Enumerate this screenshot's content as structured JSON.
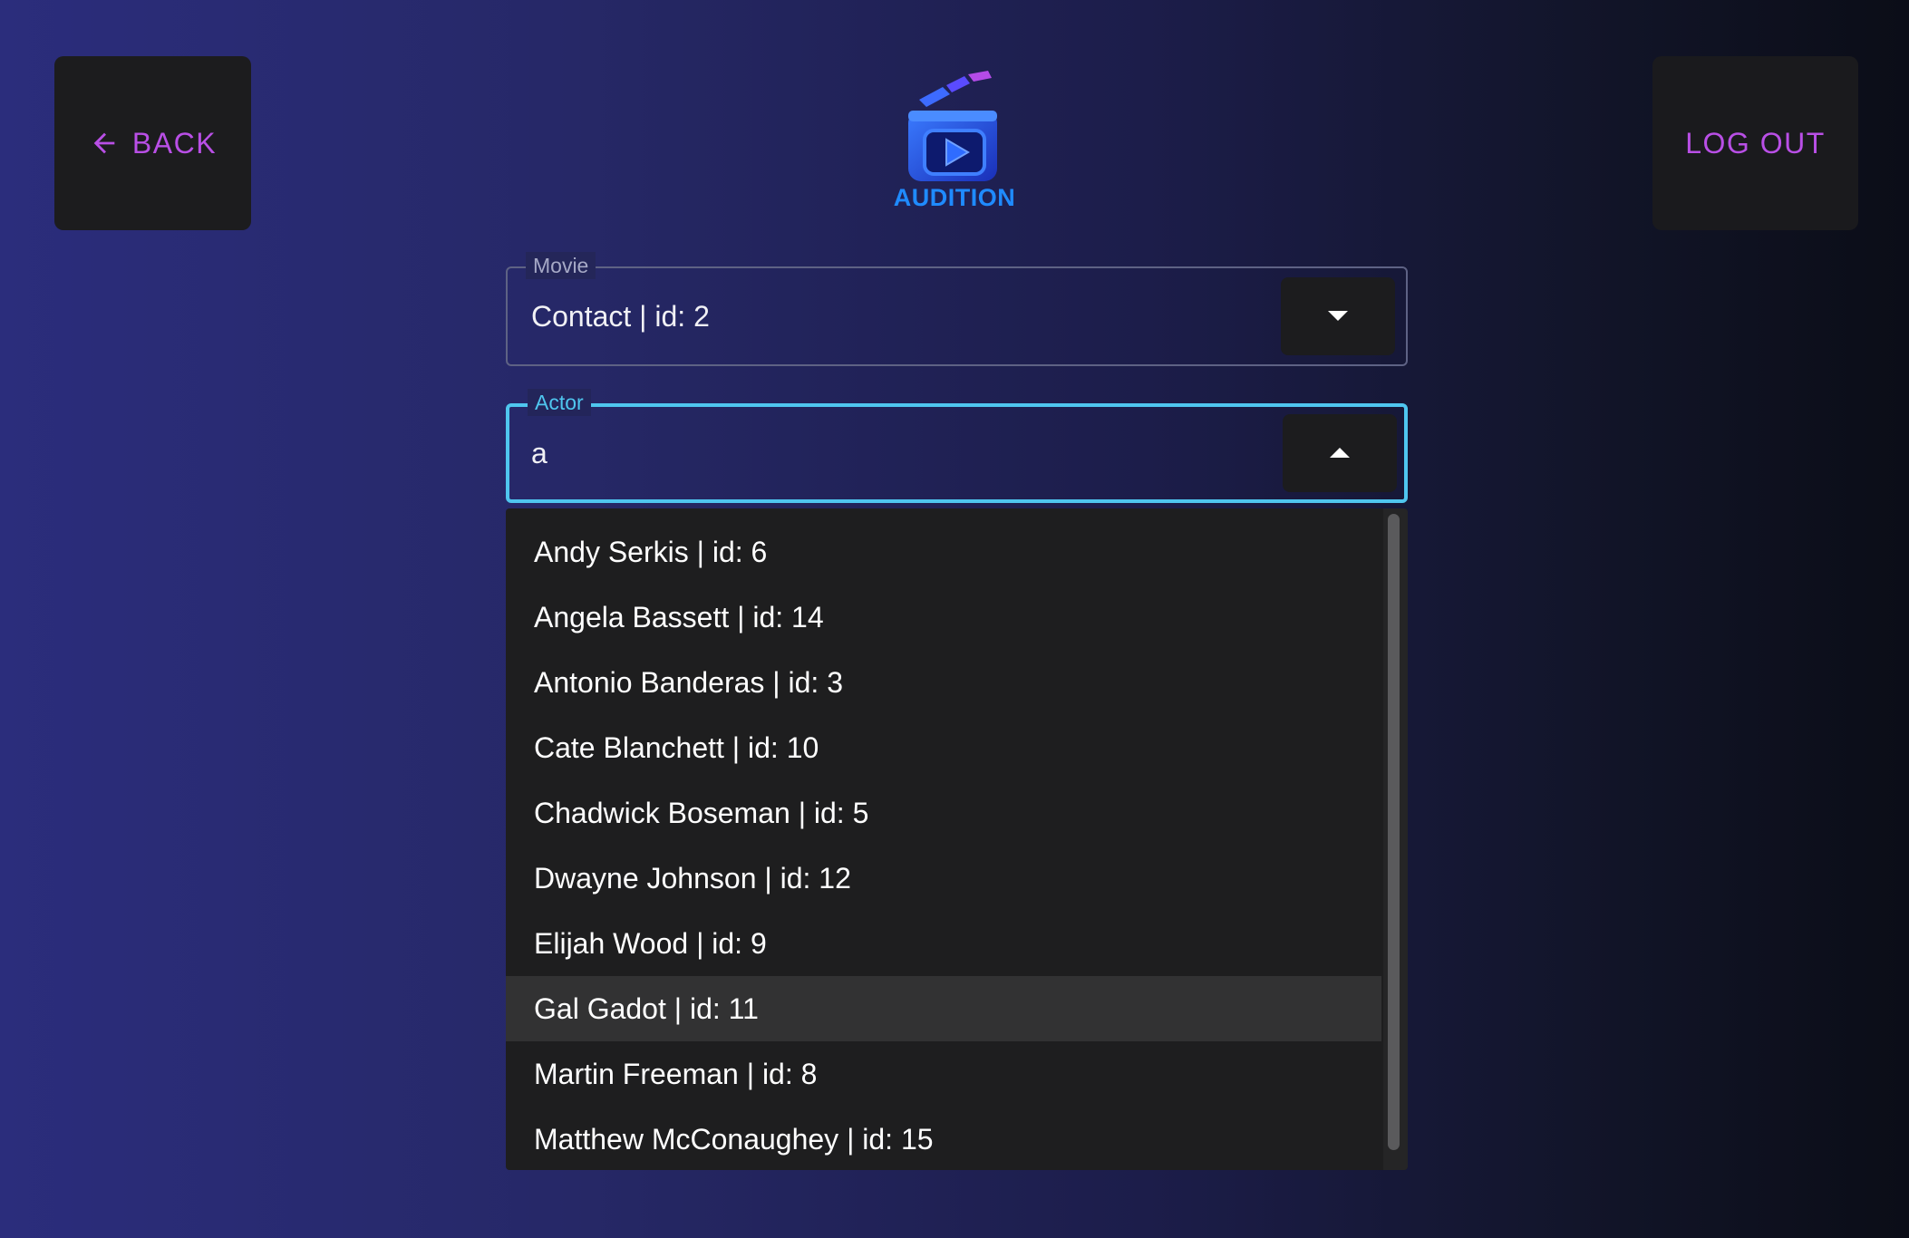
{
  "header": {
    "back_label": "BACK",
    "logout_label": "LOG OUT",
    "logo_text": "AUDITION"
  },
  "movie_field": {
    "label": "Movie",
    "value": "Contact | id: 2"
  },
  "actor_field": {
    "label": "Actor",
    "value": "a"
  },
  "actor_options": [
    "Andy Serkis | id: 6",
    "Angela Bassett | id: 14",
    "Antonio Banderas | id: 3",
    "Cate Blanchett | id: 10",
    "Chadwick Boseman | id: 5",
    "Dwayne Johnson | id: 12",
    "Elijah Wood | id: 9",
    "Gal Gadot | id: 11",
    "Martin Freeman | id: 8",
    "Matthew McConaughey | id: 15"
  ],
  "highlighted_option": "Gal Gadot | id: 11",
  "colors": {
    "accent": "#b94fe6",
    "focus": "#4fc6ef",
    "logo_blue": "#1f8bff",
    "button_bg": "#1c1c1e",
    "dropdown_bg": "#1e1e1f"
  },
  "icons": {
    "back": "arrow-left-icon",
    "movie_toggle": "caret-down-icon",
    "actor_toggle": "caret-up-icon",
    "logo": "clapperboard-play-icon"
  }
}
